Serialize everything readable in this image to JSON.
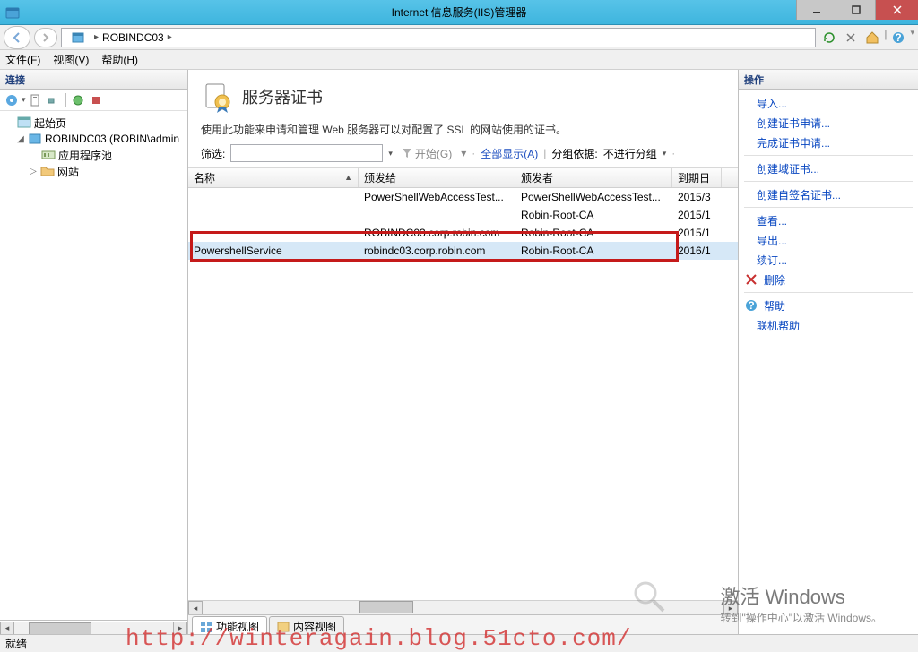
{
  "title": "Internet 信息服务(IIS)管理器",
  "breadcrumb": {
    "host": "ROBINDC03"
  },
  "menu": {
    "file": "文件(F)",
    "view": "视图(V)",
    "help": "帮助(H)"
  },
  "panels": {
    "connections": "连接",
    "actions": "操作"
  },
  "tree": {
    "start": "起始页",
    "server": "ROBINDC03 (ROBIN\\admin",
    "app_pools": "应用程序池",
    "sites": "网站"
  },
  "certs": {
    "title": "服务器证书",
    "desc": "使用此功能来申请和管理 Web 服务器可以对配置了 SSL 的网站使用的证书。",
    "filter_label": "筛选:",
    "start_label": "开始(G)",
    "showall": "全部显示(A)",
    "groupby_label": "分组依据:",
    "groupby_value": "不进行分组",
    "columns": {
      "name": "名称",
      "issued_to": "颁发给",
      "issuer": "颁发者",
      "expiry": "到期日"
    },
    "rows": [
      {
        "name": "",
        "issued_to": "PowerShellWebAccessTest...",
        "issuer": "PowerShellWebAccessTest...",
        "expiry": "2015/3"
      },
      {
        "name": "",
        "issued_to": "",
        "issuer": "Robin-Root-CA",
        "expiry": "2015/1"
      },
      {
        "name": "",
        "issued_to": "ROBINDC03.corp.robin.com",
        "issuer": "Robin-Root-CA",
        "expiry": "2015/1"
      },
      {
        "name": "PowershellService",
        "issued_to": "robindc03.corp.robin.com",
        "issuer": "Robin-Root-CA",
        "expiry": "2016/1"
      }
    ]
  },
  "actions": {
    "import": "导入...",
    "create_req": "创建证书申请...",
    "complete_req": "完成证书申请...",
    "create_domain": "创建域证书...",
    "create_self": "创建自签名证书...",
    "view": "查看...",
    "export": "导出...",
    "renew": "续订...",
    "delete": "删除",
    "help": "帮助",
    "online_help": "联机帮助"
  },
  "tabs": {
    "features": "功能视图",
    "content": "内容视图"
  },
  "status": "就绪",
  "watermark": {
    "win_big": "激活 Windows",
    "win_small": "转到\"操作中心\"以激活 Windows。",
    "url": "http://winteragain.blog.51cto.com/"
  }
}
